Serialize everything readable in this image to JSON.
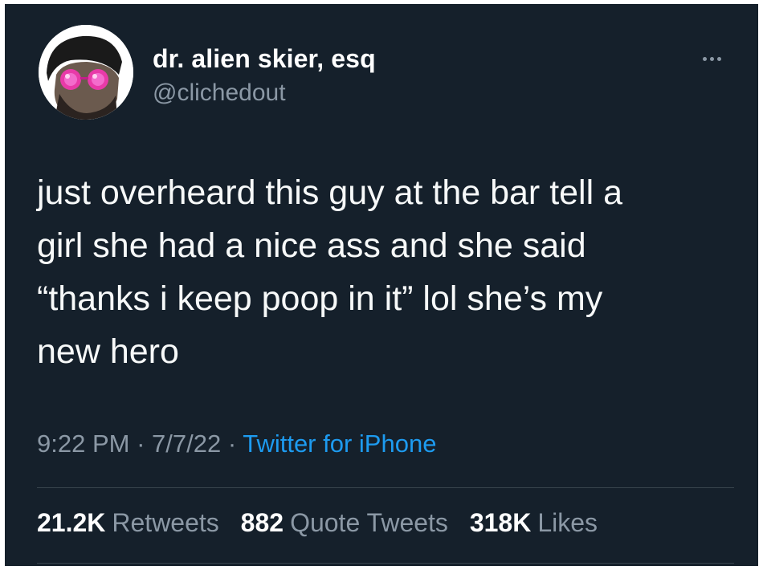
{
  "colors": {
    "background": "#15202b",
    "text_primary": "#f7f9f9",
    "text_secondary": "#8b98a5",
    "link": "#1d9bf0",
    "divider": "#38444d"
  },
  "author": {
    "display_name": "dr. alien skier, esq",
    "handle": "@clichedout",
    "avatar_icon": "avatar-photo-pink-glasses"
  },
  "tweet": {
    "lines": [
      "just overheard this guy at the bar tell a",
      "girl she had a nice ass and she said",
      "“thanks i keep poop in it” lol she’s my",
      "new hero"
    ]
  },
  "meta": {
    "time": "9:22 PM",
    "sep1": " · ",
    "date": "7/7/22",
    "sep2": " · ",
    "source": "Twitter for iPhone"
  },
  "stats": {
    "retweets": {
      "count": "21.2K",
      "label": "Retweets"
    },
    "quotes": {
      "count": "882",
      "label": "Quote Tweets"
    },
    "likes": {
      "count": "318K",
      "label": "Likes"
    }
  },
  "more_icon": "more-horizontal-icon"
}
